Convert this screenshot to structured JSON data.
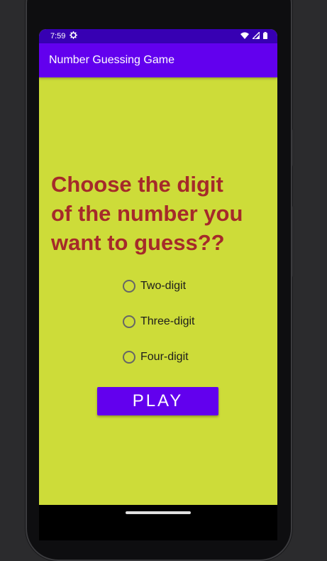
{
  "status_bar": {
    "time": "7:59",
    "icons": [
      "settings-gear-icon",
      "wifi-icon",
      "signal-icon",
      "battery-icon"
    ]
  },
  "app_bar": {
    "title": "Number Guessing Game"
  },
  "main": {
    "question_lines": [
      "Choose the digit",
      "of the number you",
      "want to guess??"
    ],
    "options": [
      {
        "label": "Two-digit",
        "selected": false
      },
      {
        "label": "Three-digit",
        "selected": false
      },
      {
        "label": "Four-digit",
        "selected": false
      }
    ],
    "play_label": "PLAY"
  },
  "colors": {
    "background": "#cddc39",
    "app_bar": "#6200ee",
    "status_bar": "#3700b3",
    "question_text": "#a52a2a",
    "button": "#6200ee"
  }
}
